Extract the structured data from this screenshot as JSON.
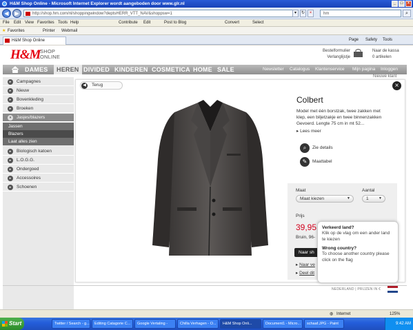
{
  "window": {
    "title": "H&M Shop Online - Microsoft Internet Explorer wordt aangeboden door www.glr.nl",
    "minimize": "_",
    "maximize": "□",
    "close": "×"
  },
  "address_bar": {
    "back": "◀",
    "forward": "▶",
    "url": "http://shop.hm.com/nl/shoppingwindow?deptsHERR_VTT_NAV&shoppsw=1",
    "dropdown": "▾",
    "refresh": "↻",
    "stop": "×",
    "search_value": "hm",
    "search_go": "⌕"
  },
  "menu": [
    "File",
    "Edit",
    "View",
    "Favorites",
    "Tools",
    "Help"
  ],
  "toolbar_links": [
    "Contribute",
    "Edit",
    "Post to Blog",
    "Convert",
    "Select"
  ],
  "favorites_bar": [
    "Favorites",
    "Printer",
    "Webmail"
  ],
  "browser_tab": {
    "label": "H&M Shop Online",
    "tools": [
      "Page",
      "Safety",
      "Tools"
    ]
  },
  "hm": {
    "logo": "H&M",
    "shop_online": [
      "SHOP",
      "ONLINE"
    ],
    "header_links": [
      "Bestelformulier",
      "Verlanglijstje"
    ],
    "cart": [
      "Naar de kassa",
      "0 artikelen"
    ],
    "nav": [
      "DAMES",
      "HEREN",
      "DIVIDED",
      "KINDEREN",
      "COSMETICA",
      "HOME",
      "SALE"
    ],
    "util_links": [
      "Newsletter",
      "Catalogus",
      "Klantenservice",
      "Mijn pagina",
      "Inloggen"
    ],
    "nieuwe_klant": "Nieuwe klant"
  },
  "sidebar": {
    "items_top": [
      "Campagnes",
      "Nieuw",
      "Bovenkleding",
      "Broeken",
      "Jasjes/blazers"
    ],
    "sub_items": [
      "Jassen",
      "Blazers",
      "Laat alles zien"
    ],
    "items_bottom": [
      "Biologisch katoen",
      "L.O.G.G.",
      "Ondergoed",
      "Accessoires",
      "Schoenen"
    ]
  },
  "product": {
    "back": "Terug",
    "close": "×",
    "title": "Colbert",
    "description": "Model met één borstzak, twee zakken met klep, een biljetzakje en twee binnenzakken Gevoerd. Lengte 75 cm in mt 52...",
    "read_more": "Lees meer",
    "zie_details": "Zie details",
    "maattabel": "Maattabel",
    "maat_label": "Maat",
    "maat_value": "Maat kiezen",
    "aantal_label": "Aantal",
    "aantal_value": "1",
    "prijs_label": "Prijs",
    "price": "39,95",
    "color": "Bruin, 96-",
    "cart_button": "Naar sh",
    "links": [
      "Naar ve",
      "Deel dit"
    ]
  },
  "country_popup": {
    "heading_nl": "Verkeerd land?",
    "text_nl": "Klik op de vlag om een ander land te kiezen",
    "heading_en": "Wrong country?",
    "text_en": "To choose another country please click on the flag"
  },
  "footer": {
    "country": "NEDERLAND | PRIJZEN IN €"
  },
  "status_bar": {
    "zone": "Internet",
    "zoom": "125%"
  },
  "taskbar": {
    "start": "Start",
    "tasks": [
      "Twitter / Search - g...",
      "Editing Catagorie C...",
      "Google Vertaling -",
      "Chilla Verhagen - O...",
      "H&M Shop Onli...",
      "Document1 - Micro...",
      "schaaf.JPG - Paint"
    ],
    "time": "9:42 AM"
  },
  "colors": {
    "hm_red": "#e50010",
    "price_red": "#d2001c",
    "nav_grey": "#8f8f8f",
    "ie_blue": "#1943b8"
  }
}
